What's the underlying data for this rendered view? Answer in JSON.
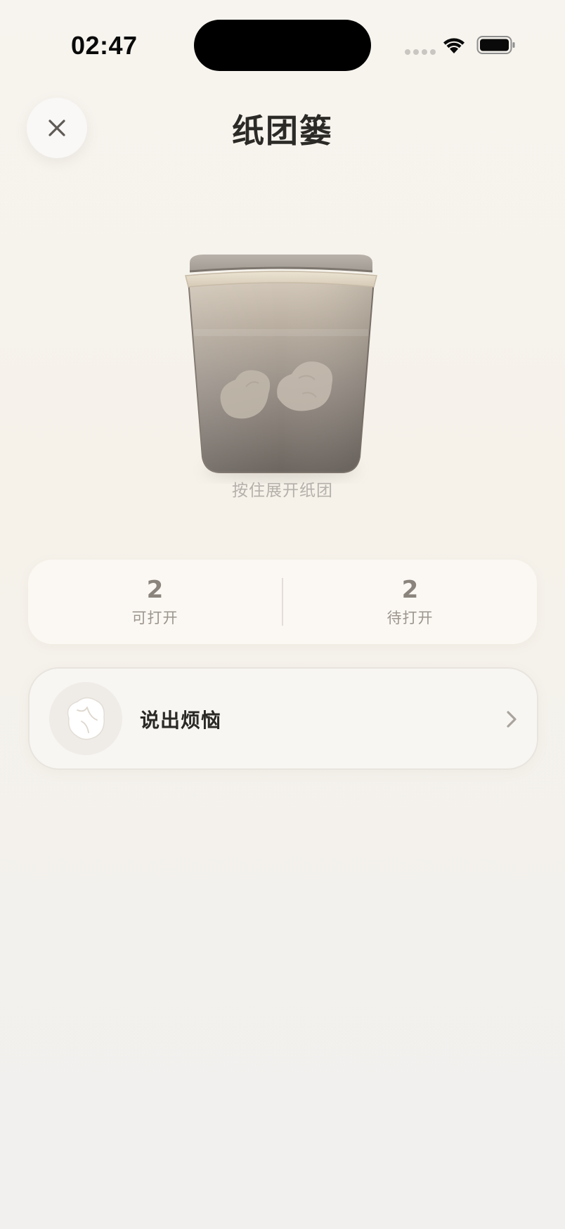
{
  "status_bar": {
    "time": "02:47"
  },
  "header": {
    "title": "纸团篓",
    "close_icon": "close-icon"
  },
  "basket": {
    "icon": "paper-basket-icon",
    "hint": "按住展开纸团"
  },
  "stats": {
    "openable": {
      "value": "2",
      "label": "可打开"
    },
    "pending": {
      "value": "2",
      "label": "待打开"
    }
  },
  "vent_action": {
    "label": "说出烦恼",
    "icon": "crumpled-paper-icon",
    "chevron": "chevron-right-icon"
  },
  "colors": {
    "background": "#f6f2ea",
    "title": "#2c2a27",
    "muted": "#9b958d",
    "basket_dark": "#6f6861",
    "basket_light": "#c9bfb2"
  }
}
